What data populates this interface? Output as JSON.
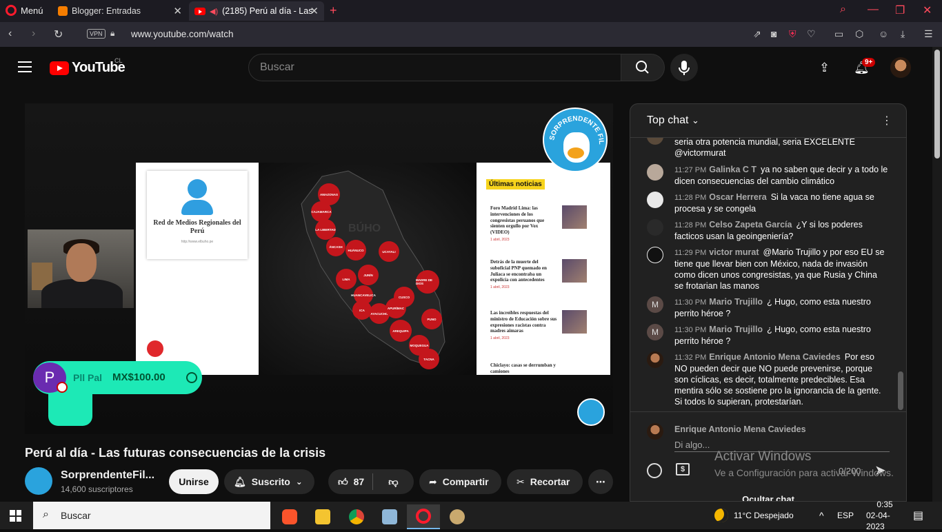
{
  "browser": {
    "menu_label": "Menú",
    "tabs": [
      {
        "title": "Blogger: Entradas",
        "active": false
      },
      {
        "title": "(2185) Perú al día - Las",
        "active": true
      }
    ],
    "new_tab_symbol": "+",
    "url": "www.youtube.com/watch",
    "vpn_label": "VPN"
  },
  "youtube": {
    "logo_text": "YouTube",
    "country_code": "CL",
    "search_placeholder": "Buscar",
    "notification_count": "9+"
  },
  "video": {
    "slide": {
      "card_title": "Red de Medios Regionales del Perú",
      "card_url": "http://www.elbuho.pe",
      "news_heading": "Últimas noticias",
      "news": [
        {
          "title": "Foro Madrid Lima: las intervenciones de los congresistas peruanos que sienten orgullo por Vox (VIDEO)",
          "date": "1 abril, 2023"
        },
        {
          "title": "Detrás de la muerte del suboficial PNP quemado en Juliaca se encontraba un expolicía con antecedentes",
          "date": "1 abril, 2023"
        },
        {
          "title": "Las increíbles respuestas del ministro de Educación sobre sus expresiones racistas contra madres aimaras",
          "date": "1 abril, 2023"
        },
        {
          "title": "Chiclayo: casas se derrumban y camiones",
          "date": ""
        }
      ],
      "regions": [
        "AMAZONAS",
        "CAJAMARCA",
        "LA LIBERTAD",
        "ÁNCASH",
        "HUÁNUCO",
        "UCAYALI",
        "LIMA",
        "JUNÍN",
        "HUANCAVELICA",
        "CUSCO",
        "MADRE DE DIOS",
        "ICA",
        "AYACUCHO",
        "APURÍMAC",
        "PUNO",
        "AREQUIPA",
        "MOQUEGUA",
        "TACNA"
      ],
      "watermark": "BÚHO"
    },
    "logo_text": "SORPRENDENTE FILMS",
    "superchat": {
      "avatar_letter": "P",
      "name": "Pll Pal",
      "amount": "MX$100.00"
    }
  },
  "info": {
    "title": "Perú al día - Las futuras consecuencias de la crisis",
    "channel": "SorprendenteFil...",
    "subscribers": "14,600 suscriptores",
    "join_label": "Unirse",
    "subscribed_label": "Suscrito",
    "likes": "87",
    "share_label": "Compartir",
    "clip_label": "Recortar"
  },
  "chat": {
    "header": "Top chat",
    "messages": [
      {
        "time": "",
        "author": "",
        "text": "seria otra potencia mundial, seria EXCELENTE @victormurat",
        "avatar_color": "#5a4a3a"
      },
      {
        "time": "11:27 PM",
        "author": "Galinka C T",
        "text": "ya no saben que decir y a todo le dicen consecuencias del cambio climático",
        "avatar_color": "#b8a89a"
      },
      {
        "time": "11:28 PM",
        "author": "Oscar Herrera",
        "text": "Si la vaca no tiene agua se procesa y se congela",
        "avatar_color": "#e8e8e8"
      },
      {
        "time": "11:28 PM",
        "author": "Celso Zapeta García",
        "text": "¿Y si los poderes facticos usan la geoingeniería?",
        "avatar_color": "#2a2a2a"
      },
      {
        "time": "11:29 PM",
        "author": "victor murat",
        "text": "@Mario Trujillo y por eso EU se tiene que llevar bien con México, nada de invasión como dicen unos congresistas, ya que Rusia y China se frotarian las manos",
        "avatar_color": "#111111"
      },
      {
        "time": "11:30 PM",
        "author": "Mario Trujillo",
        "text": "¿ Hugo, como esta nuestro perrito héroe ?",
        "avatar_color": "#5b4a46",
        "initial": "M"
      },
      {
        "time": "11:30 PM",
        "author": "Mario Trujillo",
        "text": "¿ Hugo, como esta nuestro perrito héroe ?",
        "avatar_color": "#5b4a46",
        "initial": "M"
      },
      {
        "time": "11:32 PM",
        "author": "Enrique Antonio Mena Caviedes",
        "text": "Por eso NO pueden decir que NO puede prevenirse, porque son cíclicas, es decir, totalmente predecibles. Esa mentira sólo se sostiene pro la ignorancia de la gente. Si todos lo supieran, protestarían.",
        "avatar_color": "#6b4a30"
      }
    ],
    "input_user": "Enrique Antonio Mena Caviedes",
    "input_placeholder": "Di algo...",
    "char_count": "0/200",
    "hide_label": "Ocultar chat"
  },
  "watermark": {
    "line1": "Activar Windows",
    "line2": "Ve a Configuración para activar Windows."
  },
  "taskbar": {
    "search_label": "Buscar",
    "weather": "11°C Despejado",
    "language": "ESP",
    "time": "0:35",
    "date": "02-04-2023"
  }
}
